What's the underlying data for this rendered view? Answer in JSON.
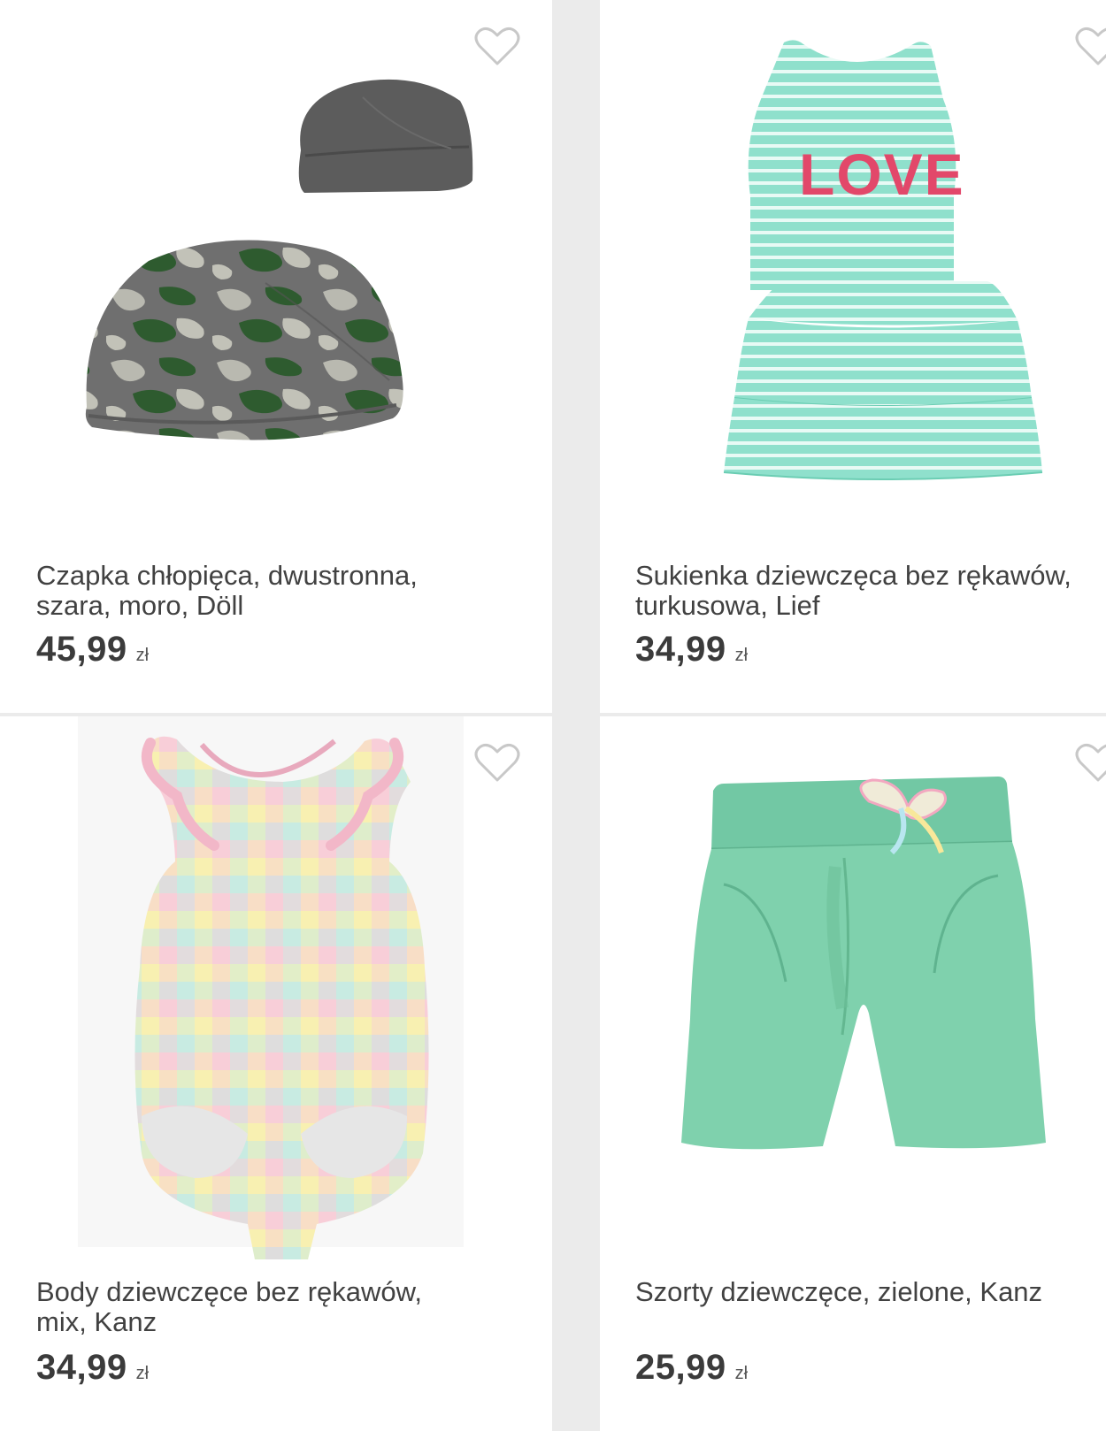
{
  "products": [
    {
      "title": "Czapka chłopięca, dwustronna,\nszara, moro, Döll",
      "price": "45,99",
      "currency": "zł",
      "favorite_icon": "heart-outline-icon"
    },
    {
      "title": "Sukienka dziewczęca bez rękawów,\nturkusowa, Lief",
      "price": "34,99",
      "currency": "zł",
      "favorite_icon": "heart-outline-icon",
      "print_text": "LOVE"
    },
    {
      "title": "Body dziewczęce bez rękawów,\nmix, Kanz",
      "price": "34,99",
      "currency": "zł",
      "favorite_icon": "heart-outline-icon"
    },
    {
      "title": "Szorty dziewczęce, zielone, Kanz",
      "price": "25,99",
      "currency": "zł",
      "favorite_icon": "heart-outline-icon"
    }
  ],
  "colors": {
    "background": "#ebebeb",
    "card": "#ffffff",
    "text": "#414141",
    "heart_outline": "#c8c8c8"
  }
}
